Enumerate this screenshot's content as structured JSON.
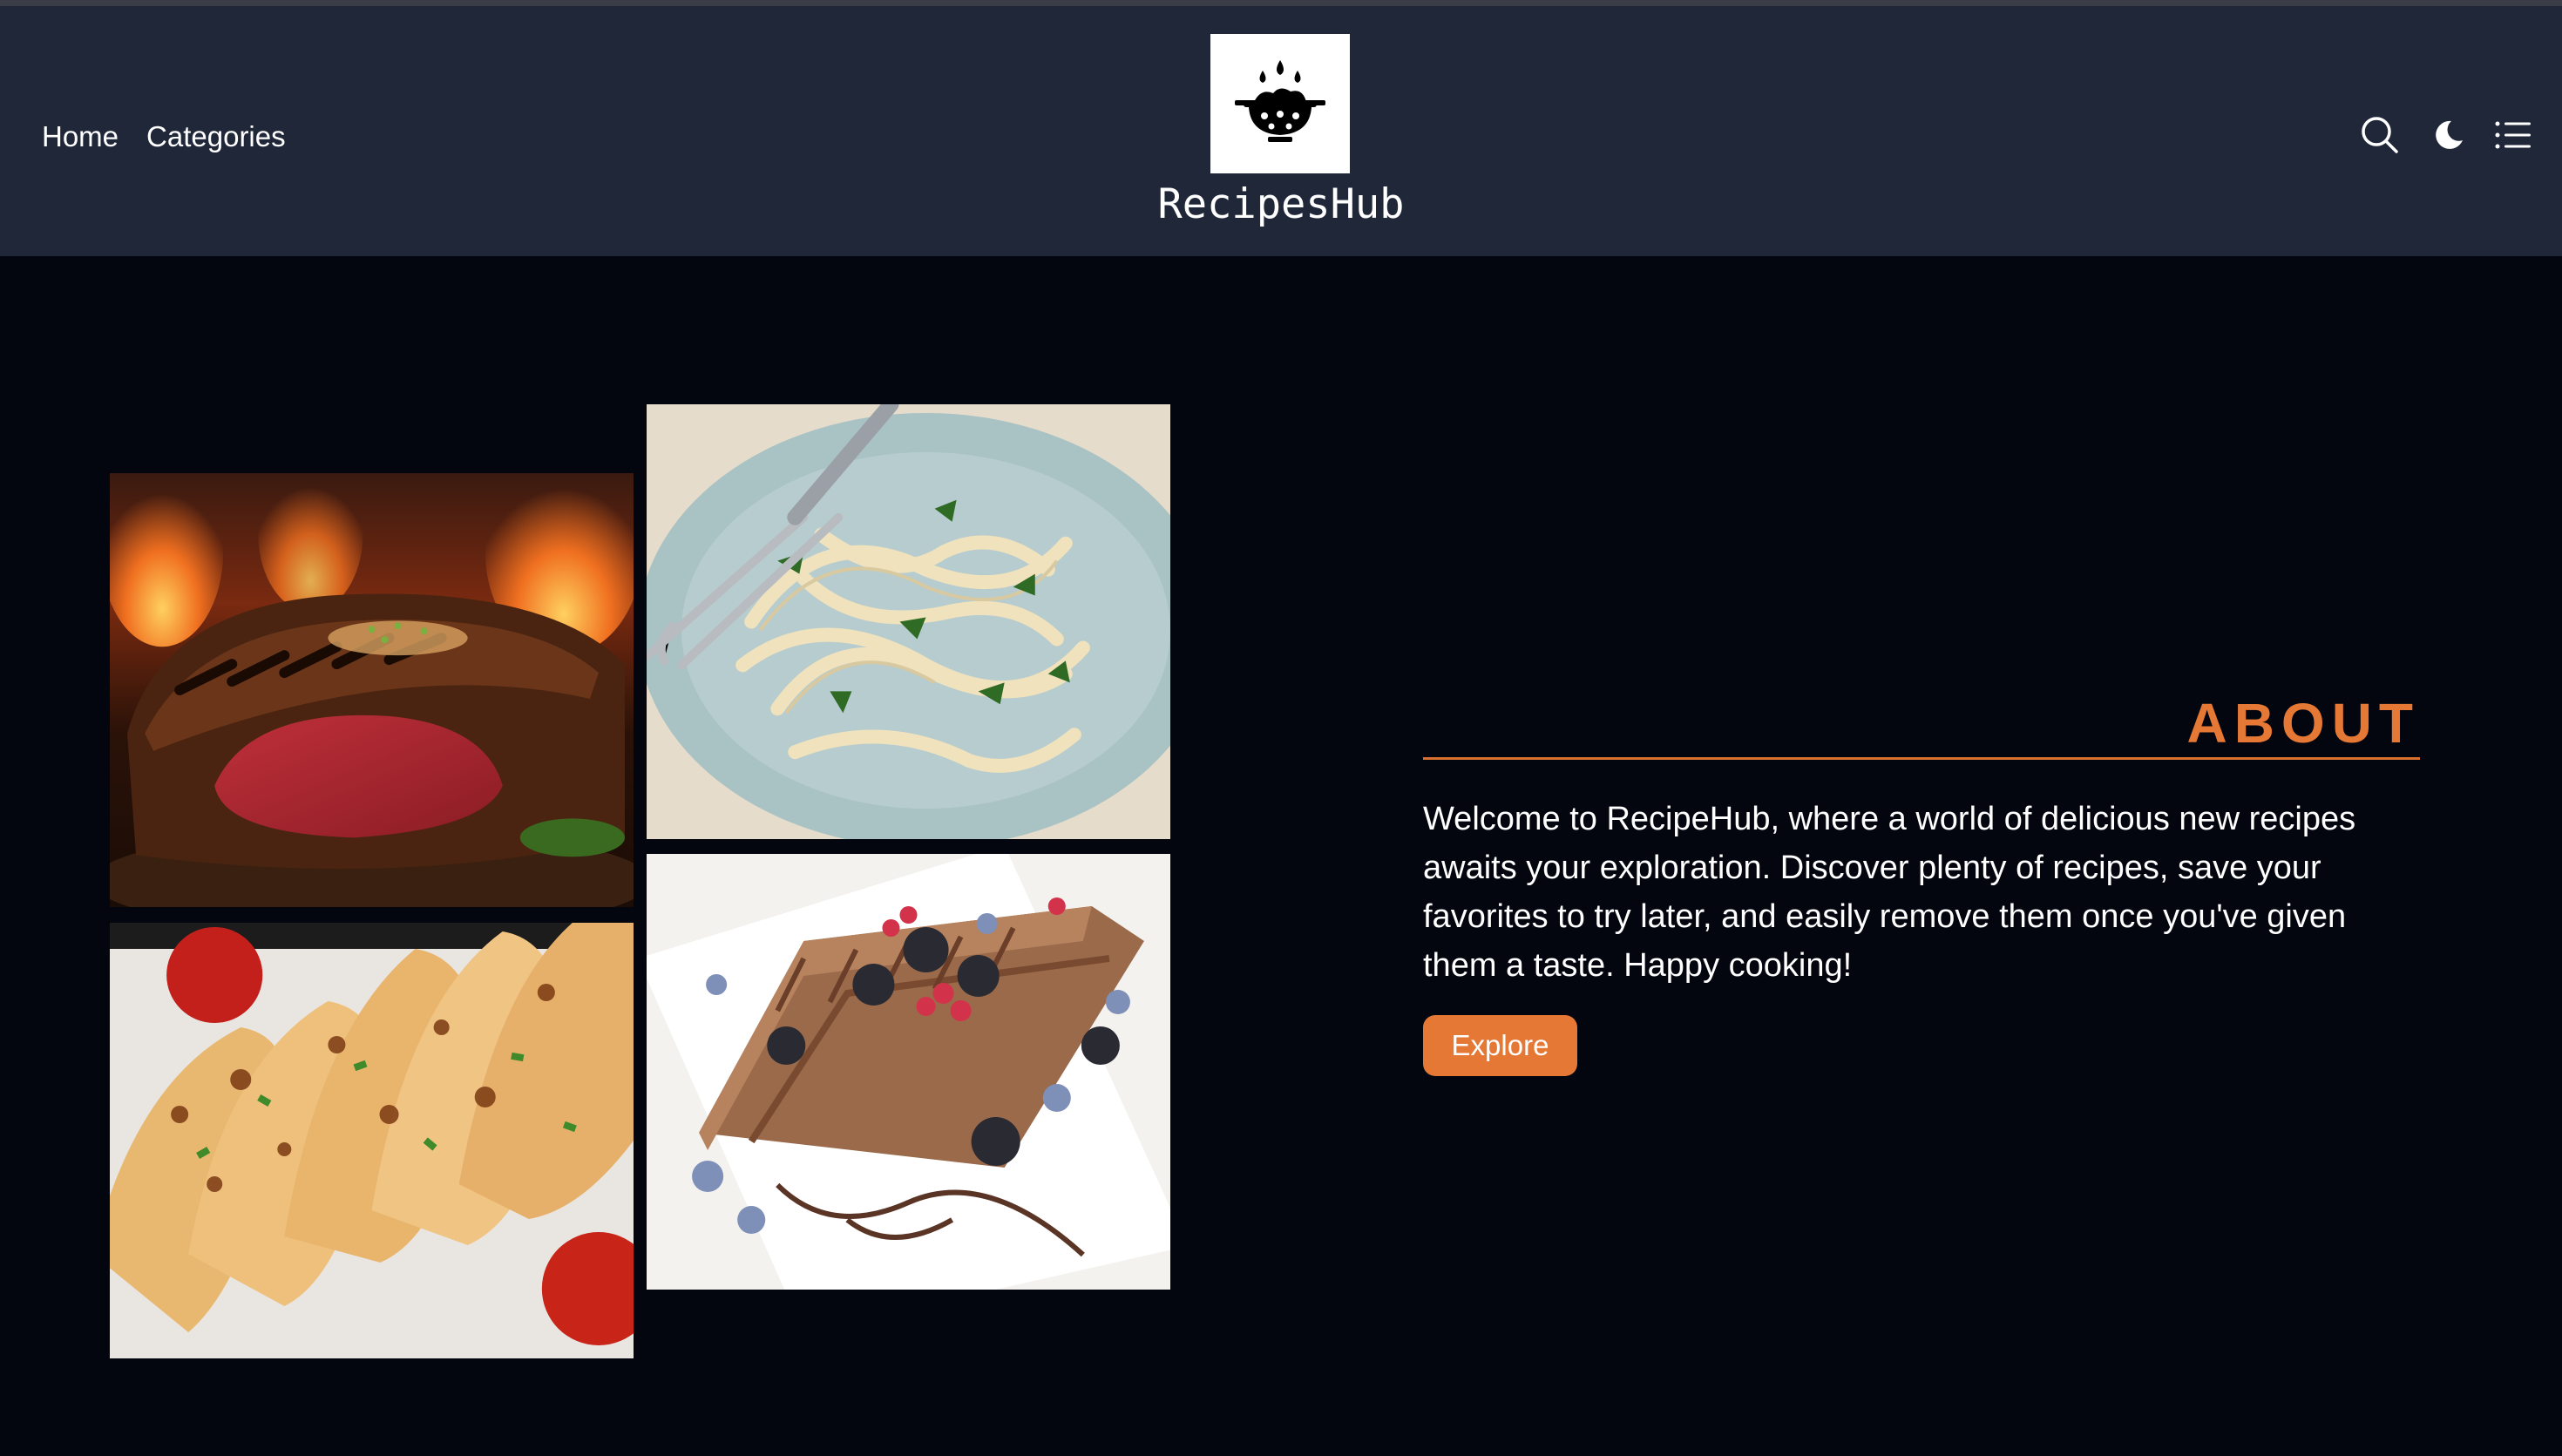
{
  "nav": {
    "items": [
      {
        "label": "Home"
      },
      {
        "label": "Categories"
      }
    ]
  },
  "brand": {
    "name": "RecipesHub",
    "logo_icon": "colander-bowl-icon"
  },
  "toolbar": {
    "icons": [
      "search-icon",
      "moon-icon",
      "list-menu-icon"
    ]
  },
  "gallery": {
    "photos": [
      {
        "name": "steak-photo",
        "subject": "grilled steak"
      },
      {
        "name": "pasta-photo",
        "subject": "fettuccine pasta"
      },
      {
        "name": "chicken-photo",
        "subject": "grilled chicken"
      },
      {
        "name": "dessert-photo",
        "subject": "chocolate dessert with berries"
      }
    ]
  },
  "about": {
    "title": "ABOUT",
    "text": "Welcome to RecipeHub, where a world of delicious new recipes awaits your exploration. Discover plenty of recipes, save your favorites to try later, and easily remove them once you've given them a taste. Happy cooking!",
    "button_label": "Explore"
  },
  "colors": {
    "header_bg": "#1f2739",
    "page_bg": "#03050f",
    "accent": "#e47834",
    "text": "#ffffff"
  }
}
